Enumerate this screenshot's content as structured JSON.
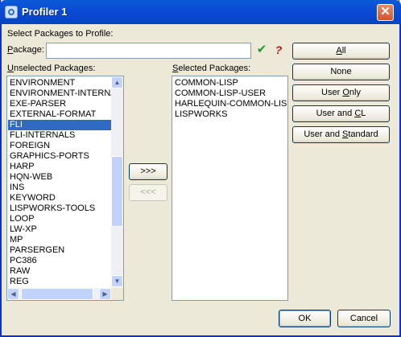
{
  "window": {
    "title": "Profiler 1",
    "close_glyph": "✕"
  },
  "prompt": "Select Packages to Profile:",
  "package": {
    "label_hot": "P",
    "label_rest": "ackage:",
    "value": "",
    "check_icon": "check-icon",
    "help_icon": "help-icon",
    "check_glyph": "✔",
    "help_glyph": "?"
  },
  "unselected": {
    "label_hot": "U",
    "label_rest": "nselected Packages:",
    "items": [
      "ENVIRONMENT",
      "ENVIRONMENT-INTERNALS",
      "EXE-PARSER",
      "EXTERNAL-FORMAT",
      "FLI",
      "FLI-INTERNALS",
      "FOREIGN",
      "GRAPHICS-PORTS",
      "HARP",
      "HQN-WEB",
      "INS",
      "KEYWORD",
      "LISPWORKS-TOOLS",
      "LOOP",
      "LW-XP",
      "MP",
      "PARSERGEN",
      "PC386",
      "RAW",
      "REG"
    ],
    "selected_index": 4
  },
  "selected": {
    "label_hot": "S",
    "label_rest": "elected Packages:",
    "items": [
      "COMMON-LISP",
      "COMMON-LISP-USER",
      "HARLEQUIN-COMMON-LISP",
      "LISPWORKS"
    ]
  },
  "move": {
    "add_label": ">>>",
    "remove_label": "<<<"
  },
  "buttons": {
    "all": {
      "hot": "A",
      "rest": "ll"
    },
    "none": {
      "label": "None"
    },
    "user_only": {
      "pre": "User ",
      "hot": "O",
      "rest": "nly"
    },
    "user_cl": {
      "pre": "User and ",
      "hot": "C",
      "rest": "L"
    },
    "user_std": {
      "pre": "User and ",
      "hot": "S",
      "rest": "tandard"
    }
  },
  "footer": {
    "ok": "OK",
    "cancel": "Cancel"
  },
  "colors": {
    "titlebar": "#0a49d4",
    "selection": "#316ac5",
    "face": "#ece9d8"
  }
}
